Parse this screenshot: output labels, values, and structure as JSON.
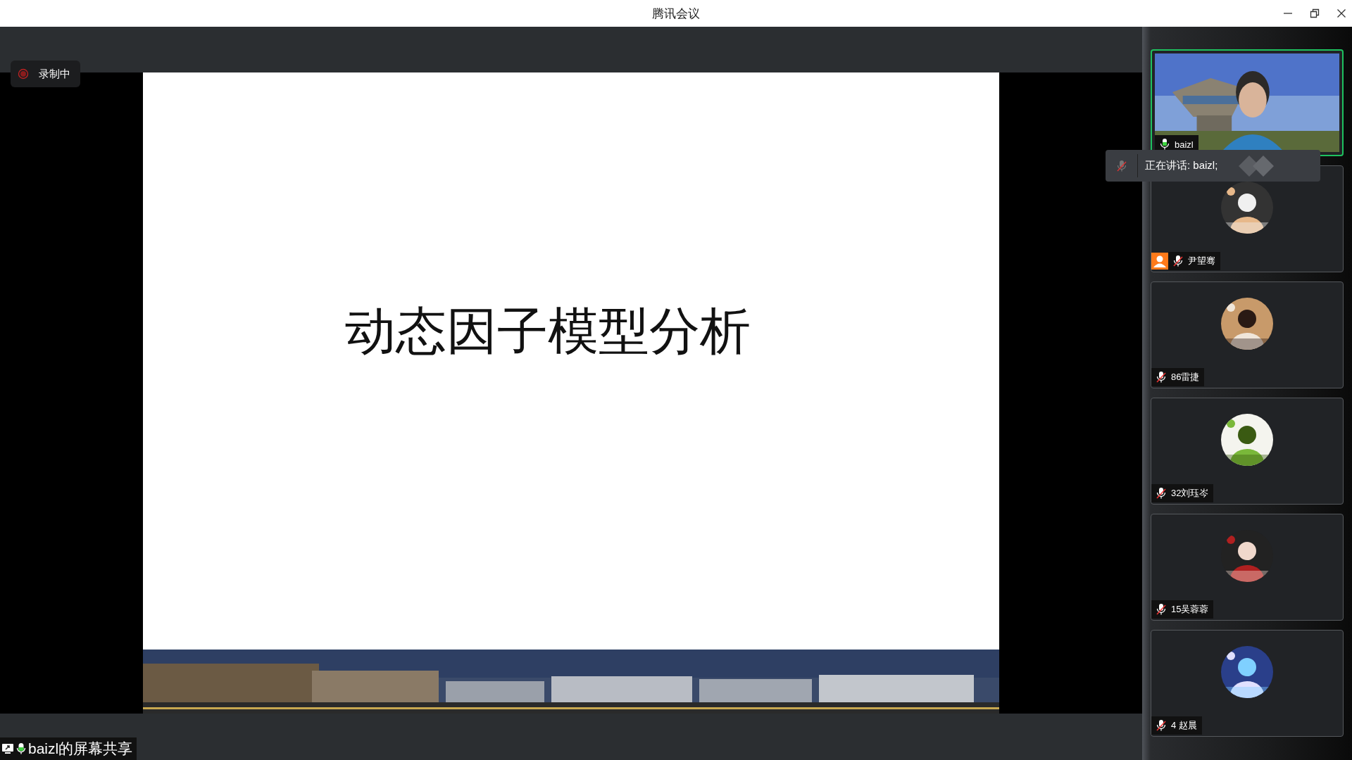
{
  "window": {
    "title": "腾讯会议"
  },
  "recording": {
    "label": "录制中"
  },
  "slide": {
    "title": "动态因子模型分析"
  },
  "share_label": {
    "text": "baizl的屏幕共享"
  },
  "speaking_toast": {
    "text": "正在讲话: baizl;"
  },
  "participants": [
    {
      "name": "baizl",
      "kind": "video",
      "muted": false,
      "speaking": true,
      "host": false
    },
    {
      "name": "尹望骞",
      "kind": "avatar",
      "muted": true,
      "speaking": false,
      "host": true
    },
    {
      "name": "86雷捷",
      "kind": "avatar",
      "muted": true,
      "speaking": false,
      "host": false
    },
    {
      "name": "32刘珏岑",
      "kind": "avatar",
      "muted": true,
      "speaking": false,
      "host": false
    },
    {
      "name": "15吴蓉蓉",
      "kind": "avatar",
      "muted": true,
      "speaking": false,
      "host": false
    },
    {
      "name": "4 赵晨",
      "kind": "avatar",
      "muted": true,
      "speaking": false,
      "host": false
    }
  ]
}
